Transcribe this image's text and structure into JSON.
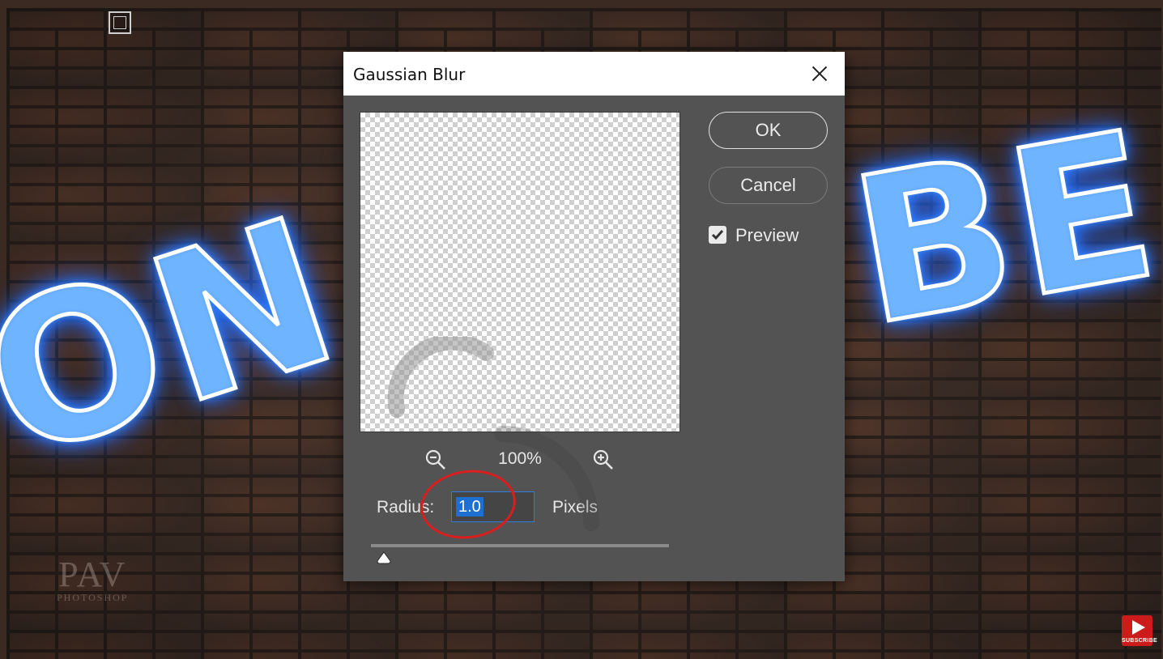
{
  "background": {
    "neon_text_left": "ON",
    "neon_text_right": "BE",
    "watermark_top": "PAV",
    "watermark_bottom": "PHOTOSHOP",
    "subscribe_label": "SUBSCRIBE"
  },
  "dialog": {
    "title": "Gaussian Blur",
    "zoom_level": "100%",
    "radius_label": "Radius:",
    "radius_value": "1.0",
    "radius_unit": "Pixels",
    "slider_value": 1.0,
    "ok_label": "OK",
    "cancel_label": "Cancel",
    "preview_label": "Preview",
    "preview_checked": true
  },
  "icons": {
    "close": "close-icon",
    "zoom_out": "zoom-out-icon",
    "zoom_in": "zoom-in-icon",
    "checkbox": "check-icon",
    "slider": "slider-thumb-icon",
    "loading": "loading-spinner-icon"
  },
  "colors": {
    "dialog_bg": "#535353",
    "accent": "#1d6fd1",
    "annotation": "#d81e1e",
    "neon_glow": "#2f7dff"
  }
}
